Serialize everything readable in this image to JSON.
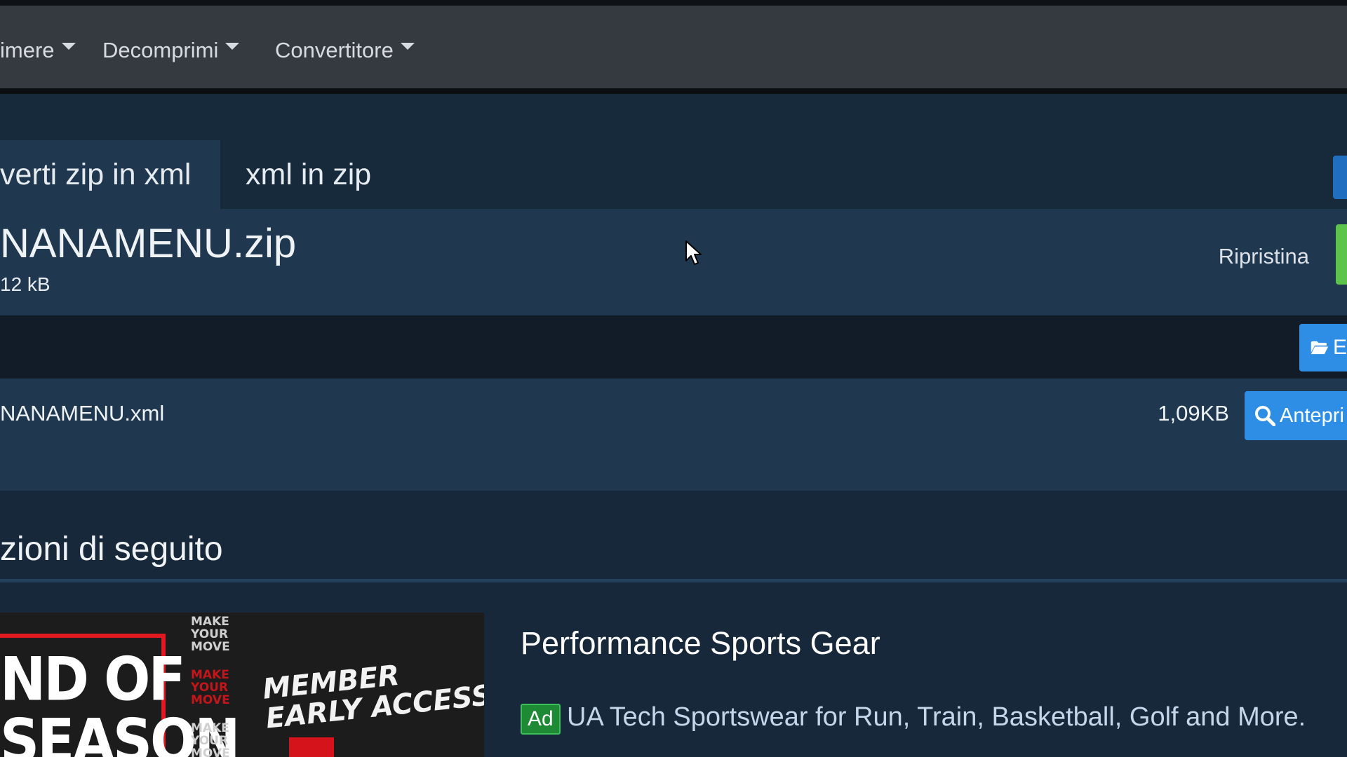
{
  "navbar": {
    "items": [
      {
        "label": "imere"
      },
      {
        "label": "Decomprimi"
      },
      {
        "label": "Convertitore"
      }
    ]
  },
  "tabs": [
    {
      "label": "verti zip in xml",
      "active": true
    },
    {
      "label": "xml in zip",
      "active": false
    }
  ],
  "archive": {
    "name": "NANAMENU.zip",
    "size": "12 kB",
    "reset_label": "Ripristina"
  },
  "entries": [
    {
      "name": "NANAMENU.xml",
      "size": "1,09KB",
      "preview_label": "Antepri"
    }
  ],
  "toolbar": {
    "browse_label": "E"
  },
  "section": {
    "title": "zioni di seguito"
  },
  "ad": {
    "image_headline": "ND OF\nSEASON",
    "image_stack": [
      "MAKE",
      "YOUR",
      "MOVE",
      "MAKE",
      "YOUR",
      "MOVE",
      "MAKE",
      "YOUR",
      "MOVE"
    ],
    "image_tagline": "MEMBER\nEARLY ACCESS",
    "title": "Performance Sports Gear",
    "badge": "Ad",
    "description": "UA Tech Sportswear for Run, Train, Basketball, Golf and More."
  },
  "colors": {
    "navbar": "#343a40",
    "page": "#16283a",
    "panel": "#1f3850",
    "primary_button": "#2e8ee6",
    "success": "#5cc44a",
    "ad_badge": "#1f8a36"
  }
}
